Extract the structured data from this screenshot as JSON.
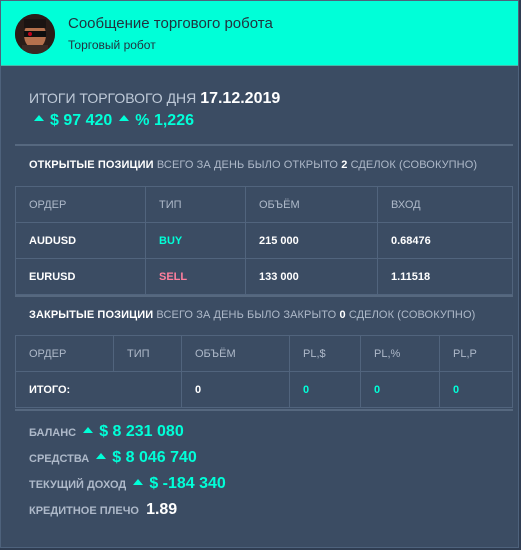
{
  "header": {
    "title": "Сообщение торгового робота",
    "subtitle": "Торговый робот"
  },
  "summary": {
    "label": "ИТОГИ ТОРГОВОГО ДНЯ",
    "date": "17.12.2019",
    "profit": "$ 97 420",
    "percent": "% 1,226"
  },
  "open": {
    "title": "ОТКРЫТЫЕ ПОЗИЦИИ",
    "desc_pre": "ВСЕГО ЗА ДЕНЬ БЫЛО ОТКРЫТО",
    "count": "2",
    "desc_post": "СДЕЛОК (СОВОКУПНО)",
    "columns": [
      "ОРДЕР",
      "ТИП",
      "ОБЪЁМ",
      "ВХОД"
    ],
    "rows": [
      {
        "order": "AUDUSD",
        "type": "BUY",
        "volume": "215 000",
        "entry": "0.68476"
      },
      {
        "order": "EURUSD",
        "type": "SELL",
        "volume": "133 000",
        "entry": "1.11518"
      }
    ]
  },
  "closed": {
    "title": "ЗАКРЫТЫЕ ПОЗИЦИИ",
    "desc_pre": "ВСЕГО ЗА ДЕНЬ БЫЛО ЗАКРЫТО",
    "count": "0",
    "desc_post": "СДЕЛОК (СОВОКУПНО)",
    "columns": [
      "ОРДЕР",
      "ТИП",
      "ОБЪЁМ",
      "PL,$",
      "PL,%",
      "PL,P"
    ],
    "total": {
      "label": "ИТОГО:",
      "volume": "0",
      "pl_usd": "0",
      "pl_pct": "0",
      "pl_p": "0"
    }
  },
  "account": {
    "balance_label": "БАЛАНС",
    "balance": "$ 8 231 080",
    "equity_label": "СРЕДСТВА",
    "equity": "$ 8 046 740",
    "income_label": "ТЕКУЩИЙ ДОХОД",
    "income": "$ -184 340",
    "leverage_label": "КРЕДИТНОЕ ПЛЕЧО",
    "leverage": "1.89"
  },
  "colors": {
    "accent": "#00ffd8",
    "sell": "#ff7f9d",
    "panel": "#3b4c63"
  },
  "icons": {
    "up": "caret-up-icon"
  }
}
